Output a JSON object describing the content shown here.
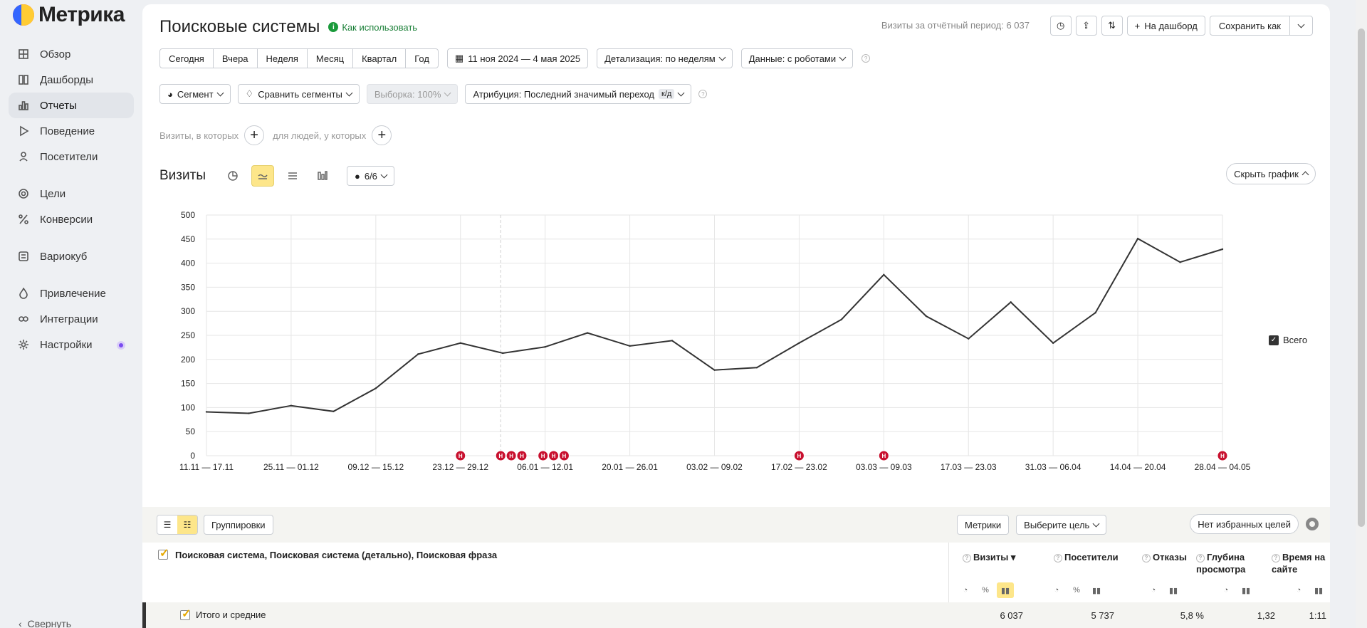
{
  "app": {
    "logo_text": "Метрика"
  },
  "sidebar": {
    "items": [
      {
        "label": "Обзор",
        "icon": "grid-icon"
      },
      {
        "label": "Дашборды",
        "icon": "dashboard-icon"
      },
      {
        "label": "Отчеты",
        "icon": "bar-chart-icon",
        "active": true
      },
      {
        "label": "Поведение",
        "icon": "play-icon"
      },
      {
        "label": "Посетители",
        "icon": "user-icon"
      },
      {
        "label": "Цели",
        "icon": "target-icon"
      },
      {
        "label": "Конверсии",
        "icon": "percent-icon"
      },
      {
        "label": "Вариокуб",
        "icon": "cube-icon"
      },
      {
        "label": "Привлечение",
        "icon": "flame-icon"
      },
      {
        "label": "Интеграции",
        "icon": "integration-icon"
      },
      {
        "label": "Настройки",
        "icon": "gear-icon"
      }
    ],
    "collapse_label": "Свернуть"
  },
  "header": {
    "title": "Поисковые системы",
    "howto": "Как использовать",
    "visits_period": "Визиты за отчётный период: 6 037",
    "to_dashboard": "На дашборд",
    "save_as": "Сохранить как"
  },
  "periods": [
    "Сегодня",
    "Вчера",
    "Неделя",
    "Месяц",
    "Квартал",
    "Год"
  ],
  "date_range": "11 ноя 2024 — 4 мая 2025",
  "detail": "Детализация: по неделям",
  "data_mode": "Данные: с роботами",
  "segment": "Сегмент",
  "compare": "Сравнить сегменты",
  "sample": "Выборка: 100%",
  "attribution": "Атрибуция: Последний значимый переход",
  "attribution_badge": "к/д",
  "filters": {
    "visits_label": "Визиты, в которых",
    "people_label": "для людей, у которых"
  },
  "chart_head": {
    "label": "Визиты",
    "notes": "6/6",
    "hide": "Скрыть график"
  },
  "legend": {
    "label": "Всего"
  },
  "chart_data": {
    "type": "line",
    "ylim": [
      0,
      500
    ],
    "yticks": [
      0,
      50,
      100,
      150,
      200,
      250,
      300,
      350,
      400,
      450,
      500
    ],
    "x_labels": [
      "11.11 — 17.11",
      "25.11 — 01.12",
      "09.12 — 15.12",
      "23.12 — 29.12",
      "06.01 — 12.01",
      "20.01 — 26.01",
      "03.02 — 09.02",
      "17.02 — 23.02",
      "03.03 — 09.03",
      "17.03 — 23.03",
      "31.03 — 06.04",
      "14.04 — 20.04",
      "28.04 — 04.05"
    ],
    "series": [
      {
        "name": "Всего",
        "color": "#333333",
        "values": [
          91,
          88,
          104,
          92,
          140,
          211,
          234,
          213,
          226,
          255,
          228,
          239,
          178,
          183,
          234,
          283,
          376,
          290,
          243,
          319,
          234,
          297,
          451,
          402,
          429
        ]
      }
    ],
    "note_marker": "Н"
  },
  "table": {
    "groupings": "Группировки",
    "metrics": "Метрики",
    "goal": "Выберите цель",
    "no_fav": "Нет избранных целей",
    "dimension_title": "Поисковая система, Поисковая система (детально), Поисковая фраза",
    "columns": [
      "Визиты",
      "Посетители",
      "Отказы",
      "Глубина просмотра",
      "Время на сайте"
    ],
    "totals_label": "Итого и средние",
    "totals": [
      "6 037",
      "5 737",
      "5,8 %",
      "1,32",
      "1:11"
    ]
  }
}
